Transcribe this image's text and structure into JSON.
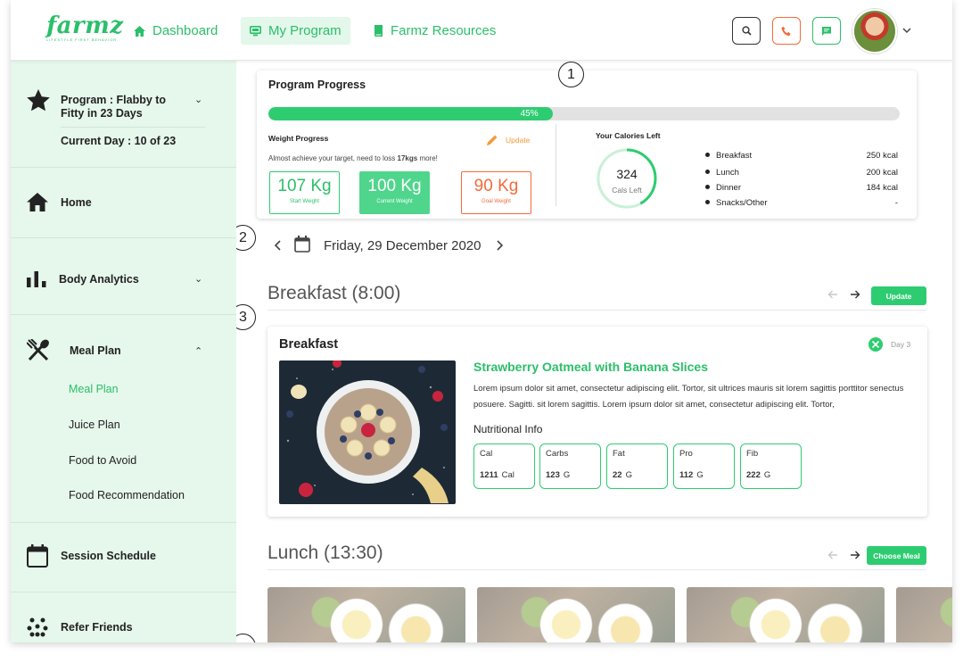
{
  "header": {
    "logo": "farmz",
    "logo_tagline": "LIFESTYLE FIRST BEHAVIOR",
    "nav": [
      {
        "label": "Dashboard",
        "icon": "home-icon"
      },
      {
        "label": "My Program",
        "icon": "monitor-icon",
        "active": true
      },
      {
        "label": "Farmz Resources",
        "icon": "book-icon"
      }
    ],
    "actions": [
      "search-icon",
      "phone-icon",
      "chat-icon"
    ],
    "accent_color": "#2ecc71",
    "phone_color": "#f26b3a"
  },
  "sidebar": {
    "program_label": "Program : Flabby to Fitty in 23 Days",
    "current_day": "Current Day : 10 of 23",
    "items": [
      {
        "label": "Home",
        "icon": "home-icon"
      },
      {
        "label": "Body Analytics",
        "icon": "bar-chart-icon"
      },
      {
        "label": "Meal Plan",
        "icon": "utensils-icon"
      },
      {
        "label": "Session Schedule",
        "icon": "calendar-icon"
      },
      {
        "label": "Refer Friends",
        "icon": "people-icon"
      }
    ],
    "meal_sub": [
      "Meal Plan",
      "Juice Plan",
      "Food to Avoid",
      "Food Recommendation"
    ]
  },
  "progress": {
    "title": "Program Progress",
    "percent": 45,
    "percent_label": "45%",
    "weight_title": "Weight Progress",
    "update_label": "Update",
    "note_pre": "Almost achieve your target, need to loss ",
    "note_bold": "17kgs",
    "note_post": " more!",
    "start": {
      "value": "107 Kg",
      "label": "Start Weight"
    },
    "current": {
      "value": "100 Kg",
      "label": "Current Weight"
    },
    "goal": {
      "value": "90 Kg",
      "label": "Goal Weight"
    },
    "calories_title": "Your Calories Left",
    "cals_left": "324",
    "cals_left_label": "Cals Left",
    "cals_ring_fraction": 0.42,
    "meals": [
      {
        "name": "Breakfast",
        "kcal": "250 kcal"
      },
      {
        "name": "Lunch",
        "kcal": "200 kcal"
      },
      {
        "name": "Dinner",
        "kcal": "184 kcal"
      },
      {
        "name": "Snacks/Other",
        "kcal": "-"
      }
    ]
  },
  "date": {
    "label": "Friday, 29 December 2020"
  },
  "breakfast": {
    "section_title": "Breakfast (8:00)",
    "update_button": "Update",
    "card_title": "Breakfast",
    "day_label": "Day 3",
    "recipe": "Strawberry Oatmeal with Banana Slices",
    "description": "Lorem ipsum dolor sit amet, consectetur adipiscing elit. Tortor, sit ultrices mauris sit lorem sagittis porttitor senectus posuere. Sagitti. sit lorem sagittis. Lorem ipsum dolor sit amet, consectetur adipiscing elit. Tortor,",
    "nutri_title": "Nutritional Info",
    "nutrients": [
      {
        "name": "Cal",
        "value": "1211",
        "unit": "Cal"
      },
      {
        "name": "Carbs",
        "value": "123",
        "unit": "G"
      },
      {
        "name": "Fat",
        "value": "22",
        "unit": "G"
      },
      {
        "name": "Pro",
        "value": "112",
        "unit": "G"
      },
      {
        "name": "Fib",
        "value": "222",
        "unit": "G"
      }
    ]
  },
  "lunch": {
    "section_title": "Lunch (13:30)",
    "choose_button": "Choose Meal"
  },
  "markers": [
    "1",
    "2",
    "3"
  ]
}
